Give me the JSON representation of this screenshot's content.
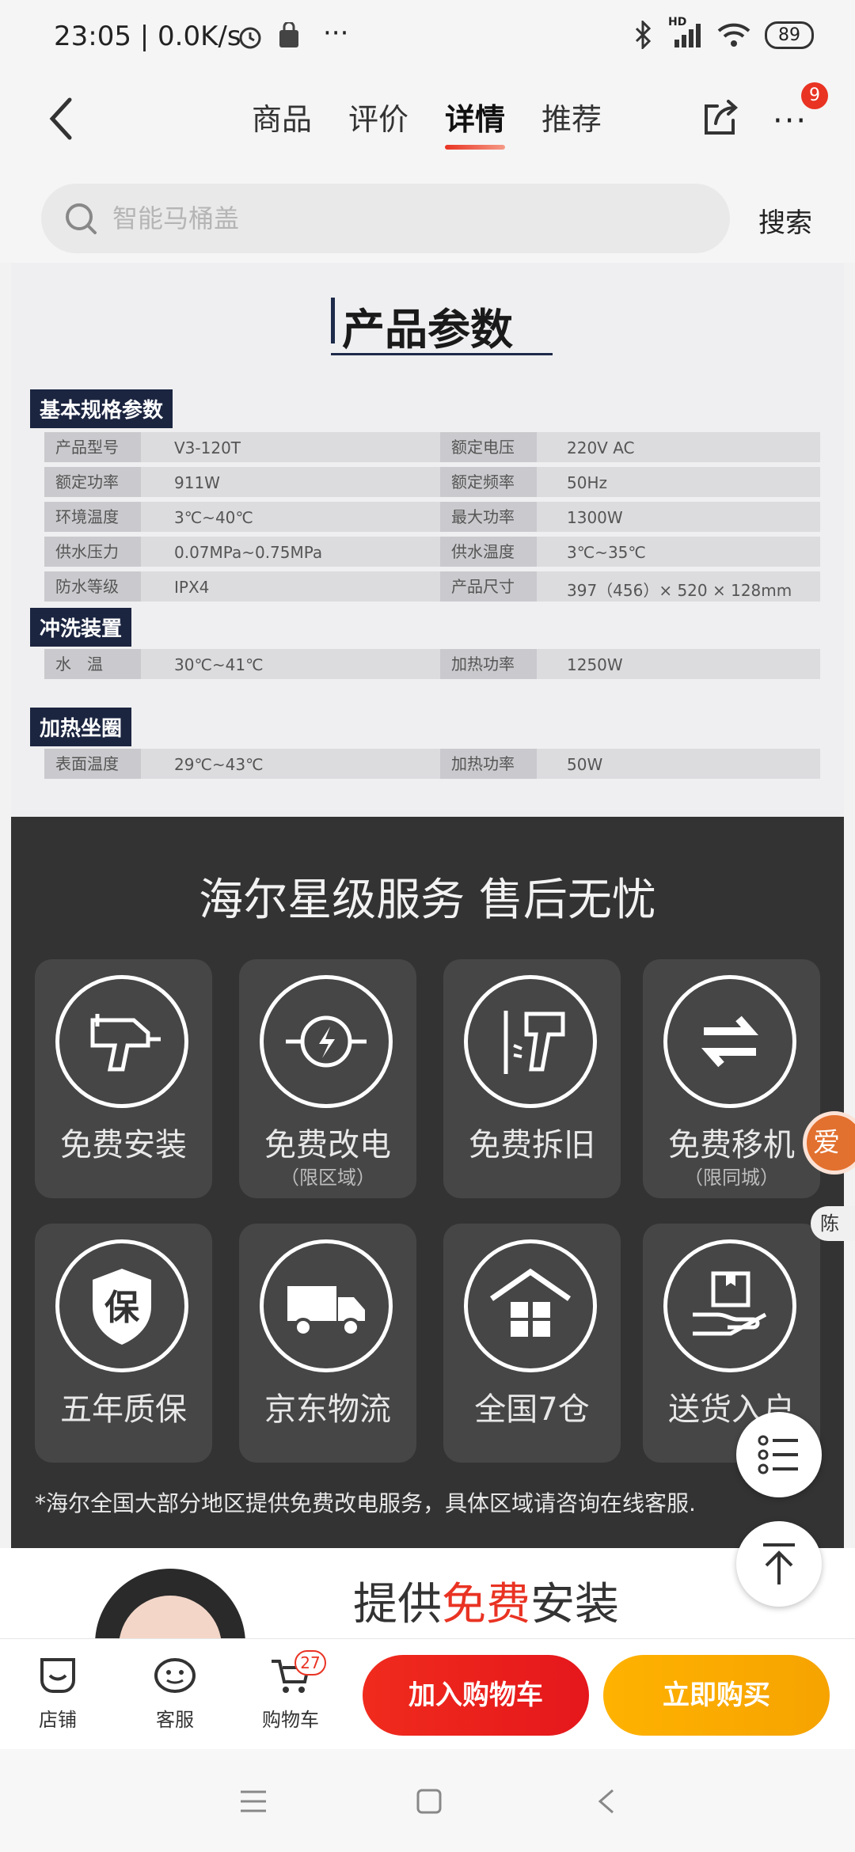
{
  "status_bar": {
    "time": "23:05 | 0.0K/s",
    "battery": "89",
    "signal_label": "HD"
  },
  "nav": {
    "tabs": [
      "商品",
      "评价",
      "详情",
      "推荐"
    ],
    "active_tab": "详情",
    "more_badge": "9"
  },
  "search": {
    "placeholder": "智能马桶盖",
    "button": "搜索"
  },
  "params": {
    "title": "产品参数",
    "sections": [
      {
        "name": "基本规格参数",
        "rows": [
          [
            "产品型号",
            "V3-120T",
            "额定电压",
            "220V AC"
          ],
          [
            "额定功率",
            "911W",
            "额定频率",
            "50Hz"
          ],
          [
            "环境温度",
            "3℃~40℃",
            "最大功率",
            "1300W"
          ],
          [
            "供水压力",
            "0.07MPa~0.75MPa",
            "供水温度",
            "3℃~35℃"
          ],
          [
            "防水等级",
            "IPX4",
            "产品尺寸",
            "397（456）× 520 × 128mm"
          ]
        ]
      },
      {
        "name": "冲洗装置",
        "rows": [
          [
            "水　温",
            "30℃~41℃",
            "加热功率",
            "1250W"
          ]
        ]
      },
      {
        "name": "加热坐圈",
        "rows": [
          [
            "表面温度",
            "29℃~43℃",
            "加热功率",
            "50W"
          ]
        ]
      }
    ]
  },
  "service": {
    "title": "海尔星级服务 售后无忧",
    "cards": [
      {
        "label": "免费安装",
        "sub": "",
        "icon": "drill-icon"
      },
      {
        "label": "免费改电",
        "sub": "（限区域）",
        "icon": "electric-icon"
      },
      {
        "label": "免费拆旧",
        "sub": "",
        "icon": "hammer-icon"
      },
      {
        "label": "免费移机",
        "sub": "（限同城）",
        "icon": "exchange-icon"
      },
      {
        "label": "五年质保",
        "sub": "",
        "icon": "shield-icon",
        "glyph": "保"
      },
      {
        "label": "京东物流",
        "sub": "",
        "icon": "truck-icon"
      },
      {
        "label": "全国7仓",
        "sub": "",
        "icon": "warehouse-icon"
      },
      {
        "label": "送货入户",
        "sub": "",
        "icon": "package-icon"
      }
    ],
    "note": "*海尔全国大部分地区提供免费改电服务，具体区域请咨询在线客服."
  },
  "promo": {
    "text_before": "提供",
    "text_highlight": "免费",
    "text_after": "安装"
  },
  "floating": {
    "side_avatar_text": "爱",
    "side_name": "陈"
  },
  "bottom_bar": {
    "shop": "店铺",
    "service": "客服",
    "cart": "购物车",
    "cart_badge": "27",
    "add_to_cart": "加入购物车",
    "buy_now": "立即购买"
  },
  "colors": {
    "accent": "#e93323",
    "buy": "#ffb000",
    "dark_panel": "#333333",
    "param_header": "#1b2540"
  }
}
